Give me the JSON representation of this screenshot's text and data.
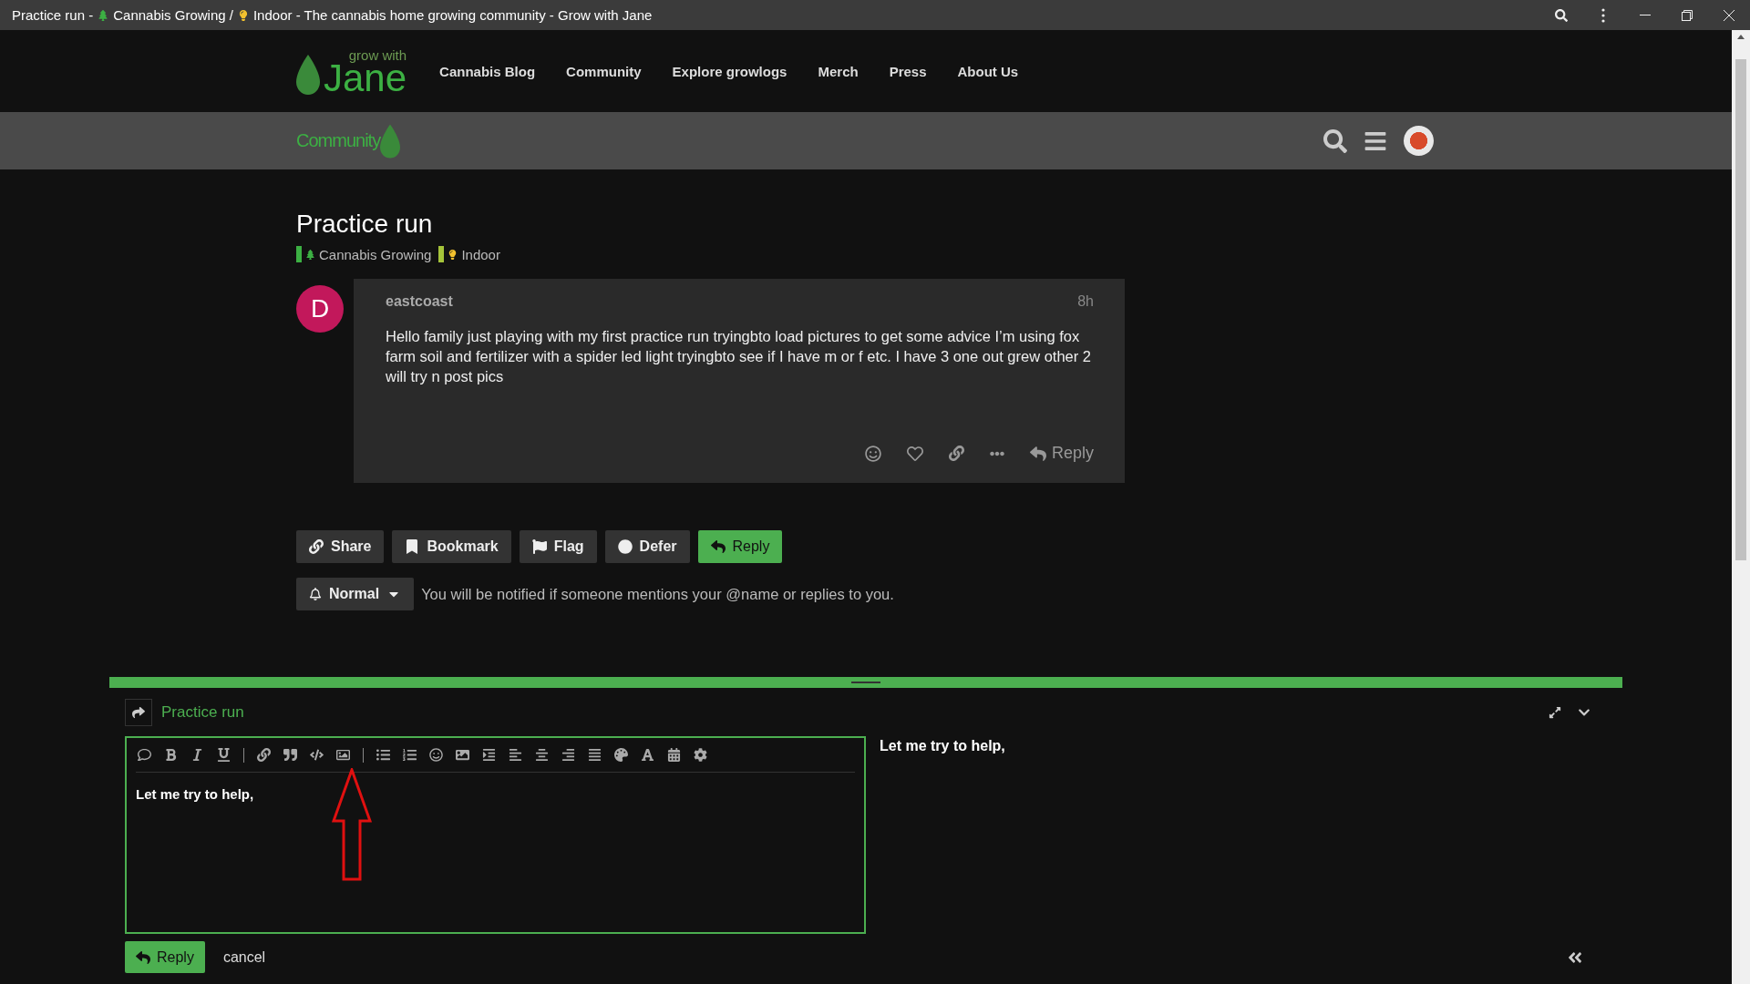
{
  "window": {
    "title_parts": [
      "Practice run -",
      "Cannabis Growing /",
      "Indoor - The cannabis home growing community - Grow with Jane"
    ]
  },
  "header": {
    "logo_small": "grow with",
    "logo_big": "Jane",
    "nav": [
      "Cannabis Blog",
      "Community",
      "Explore growlogs",
      "Merch",
      "Press",
      "About Us"
    ]
  },
  "subheader": {
    "logo": "Community"
  },
  "topic": {
    "title": "Practice run",
    "categories": [
      {
        "name": "Cannabis Growing",
        "color": "#3cb043",
        "kind": "tree"
      },
      {
        "name": "Indoor",
        "color": "#a5c43a",
        "kind": "bulb"
      }
    ]
  },
  "post": {
    "avatar_letter": "D",
    "username": "eastcoast",
    "age": "8h",
    "body": "Hello family just playing with my first practice run tryingbto load pictures to get some advice I’m using fox farm soil and fertilizer with a spider led light tryingbto see if I have m or f etc. I have 3 one out grew other 2 will try n post pics",
    "reply": "Reply"
  },
  "topic_buttons": [
    {
      "kind": "share",
      "label": "Share"
    },
    {
      "kind": "bookmark",
      "label": "Bookmark"
    },
    {
      "kind": "flag",
      "label": "Flag"
    },
    {
      "kind": "defer",
      "label": "Defer"
    },
    {
      "kind": "reply",
      "label": "Reply"
    }
  ],
  "notifications": {
    "level": "Normal",
    "description": "You will be notified if someone mentions your @name or replies to you."
  },
  "composer": {
    "reply_to": "Practice run",
    "value": "Let me try to help,",
    "preview": "Let me try to help,",
    "submit": "Reply",
    "cancel": "cancel"
  }
}
